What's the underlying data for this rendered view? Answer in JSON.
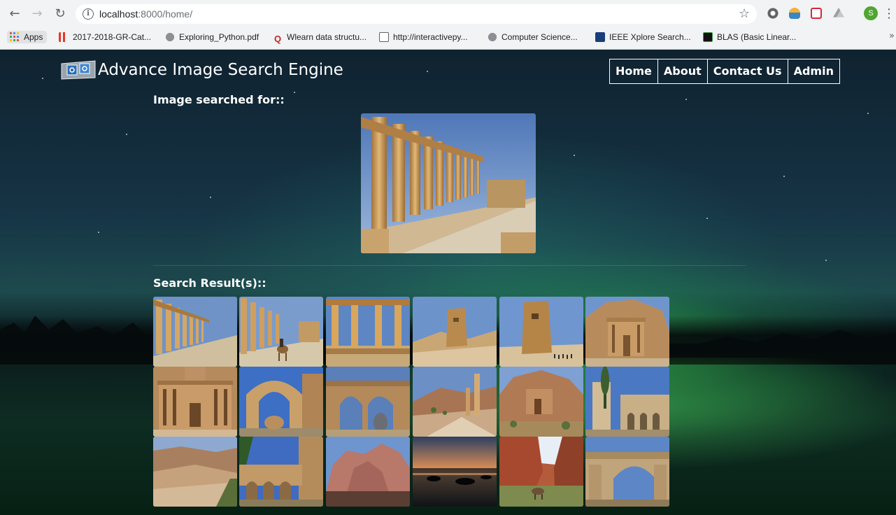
{
  "browser": {
    "url_host": "localhost",
    "url_rest": ":8000/home/",
    "profile_initial": "S",
    "bookmarks": [
      {
        "label": "Apps",
        "icon": "apps-grid-icon"
      },
      {
        "label": "2017-2018-GR-Cat...",
        "icon": "bookmark-red-bars-icon"
      },
      {
        "label": "Exploring_Python.pdf",
        "icon": "globe-icon"
      },
      {
        "label": "Wlearn data structu...",
        "icon": "q-logo-icon"
      },
      {
        "label": "http://interactivepy...",
        "icon": "page-icon"
      },
      {
        "label": "Computer Science...",
        "icon": "globe-icon"
      },
      {
        "label": "IEEE Xplore Search...",
        "icon": "ieee-icon"
      },
      {
        "label": "BLAS (Basic Linear...",
        "icon": "blas-icon"
      }
    ],
    "more_label": "»"
  },
  "site": {
    "title": "Advance Image Search Engine",
    "nav": [
      "Home",
      "About",
      "Contact Us",
      "Admin"
    ],
    "query_label": "Image searched for::",
    "results_label": "Search Result(s)::"
  },
  "results": [
    {
      "name": "colonnade-street"
    },
    {
      "name": "colonnade-camel-rider"
    },
    {
      "name": "tetrapylon-columns"
    },
    {
      "name": "funerary-tower"
    },
    {
      "name": "funerary-tower-tourists"
    },
    {
      "name": "petra-monastery-wide"
    },
    {
      "name": "petra-monastery-facade"
    },
    {
      "name": "arch-ruin-blue-sky"
    },
    {
      "name": "arch-ruin-stone"
    },
    {
      "name": "column-valley"
    },
    {
      "name": "rock-tomb-cliff"
    },
    {
      "name": "castle-tower-tree"
    },
    {
      "name": "desert-valley"
    },
    {
      "name": "aqueduct-tower"
    },
    {
      "name": "red-rock-mountain"
    },
    {
      "name": "sunset-lake"
    },
    {
      "name": "canyon-donkey"
    },
    {
      "name": "arch-gate-ruin"
    }
  ]
}
